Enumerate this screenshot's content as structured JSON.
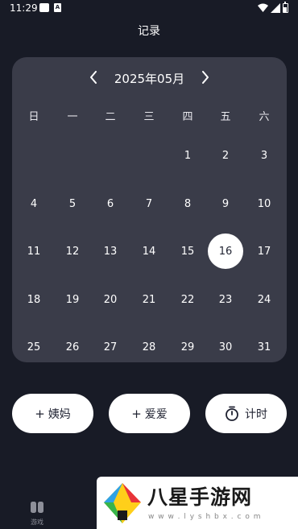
{
  "status_bar": {
    "time": "11:29",
    "badge_letter": "A"
  },
  "header": {
    "title": "记录"
  },
  "calendar": {
    "month_label": "2025年05月",
    "weekdays": [
      "日",
      "一",
      "二",
      "三",
      "四",
      "五",
      "六"
    ],
    "weeks": [
      [
        "",
        "",
        "",
        "",
        "1",
        "2",
        "3"
      ],
      [
        "4",
        "5",
        "6",
        "7",
        "8",
        "9",
        "10"
      ],
      [
        "11",
        "12",
        "13",
        "14",
        "15",
        "16",
        "17"
      ],
      [
        "18",
        "19",
        "20",
        "21",
        "22",
        "23",
        "24"
      ],
      [
        "25",
        "26",
        "27",
        "28",
        "29",
        "30",
        "31"
      ]
    ],
    "selected_day": "16"
  },
  "actions": {
    "plus_symbol": "+",
    "btn1_label": "姨妈",
    "btn2_label": "爱爱",
    "btn3_label": "计时"
  },
  "bottom_nav": {
    "game_label": "游戏"
  },
  "watermark": {
    "text": "八星手游网",
    "url": "w w w . l y s h b x . c o m"
  },
  "colors": {
    "background": "#181b26",
    "card": "#3a3c49",
    "button_bg": "#ffffff",
    "button_text": "#1e2130"
  }
}
